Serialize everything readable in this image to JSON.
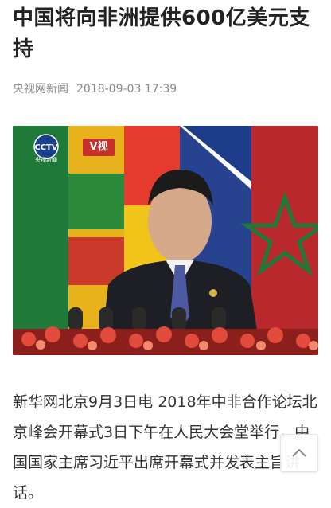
{
  "article": {
    "title": "中国将向非洲提供600亿美元支持",
    "source": "央视网新闻",
    "datetime": "2018-09-03 17:39",
    "body": "新华网北京9月3日电 2018年中非合作论坛北京峰会开幕式3日下午在人民大会堂举行，中国国家主席习近平出席开幕式并发表主旨讲话。"
  },
  "video": {
    "logo_text": "央视新闻",
    "logo_brand": "CCTV",
    "badge": "V视"
  },
  "icons": {
    "back_to_top": "chevron-up-icon"
  },
  "colors": {
    "badge": "#c8302c",
    "meta_text": "#8a8a8a",
    "title_text": "#222222"
  }
}
